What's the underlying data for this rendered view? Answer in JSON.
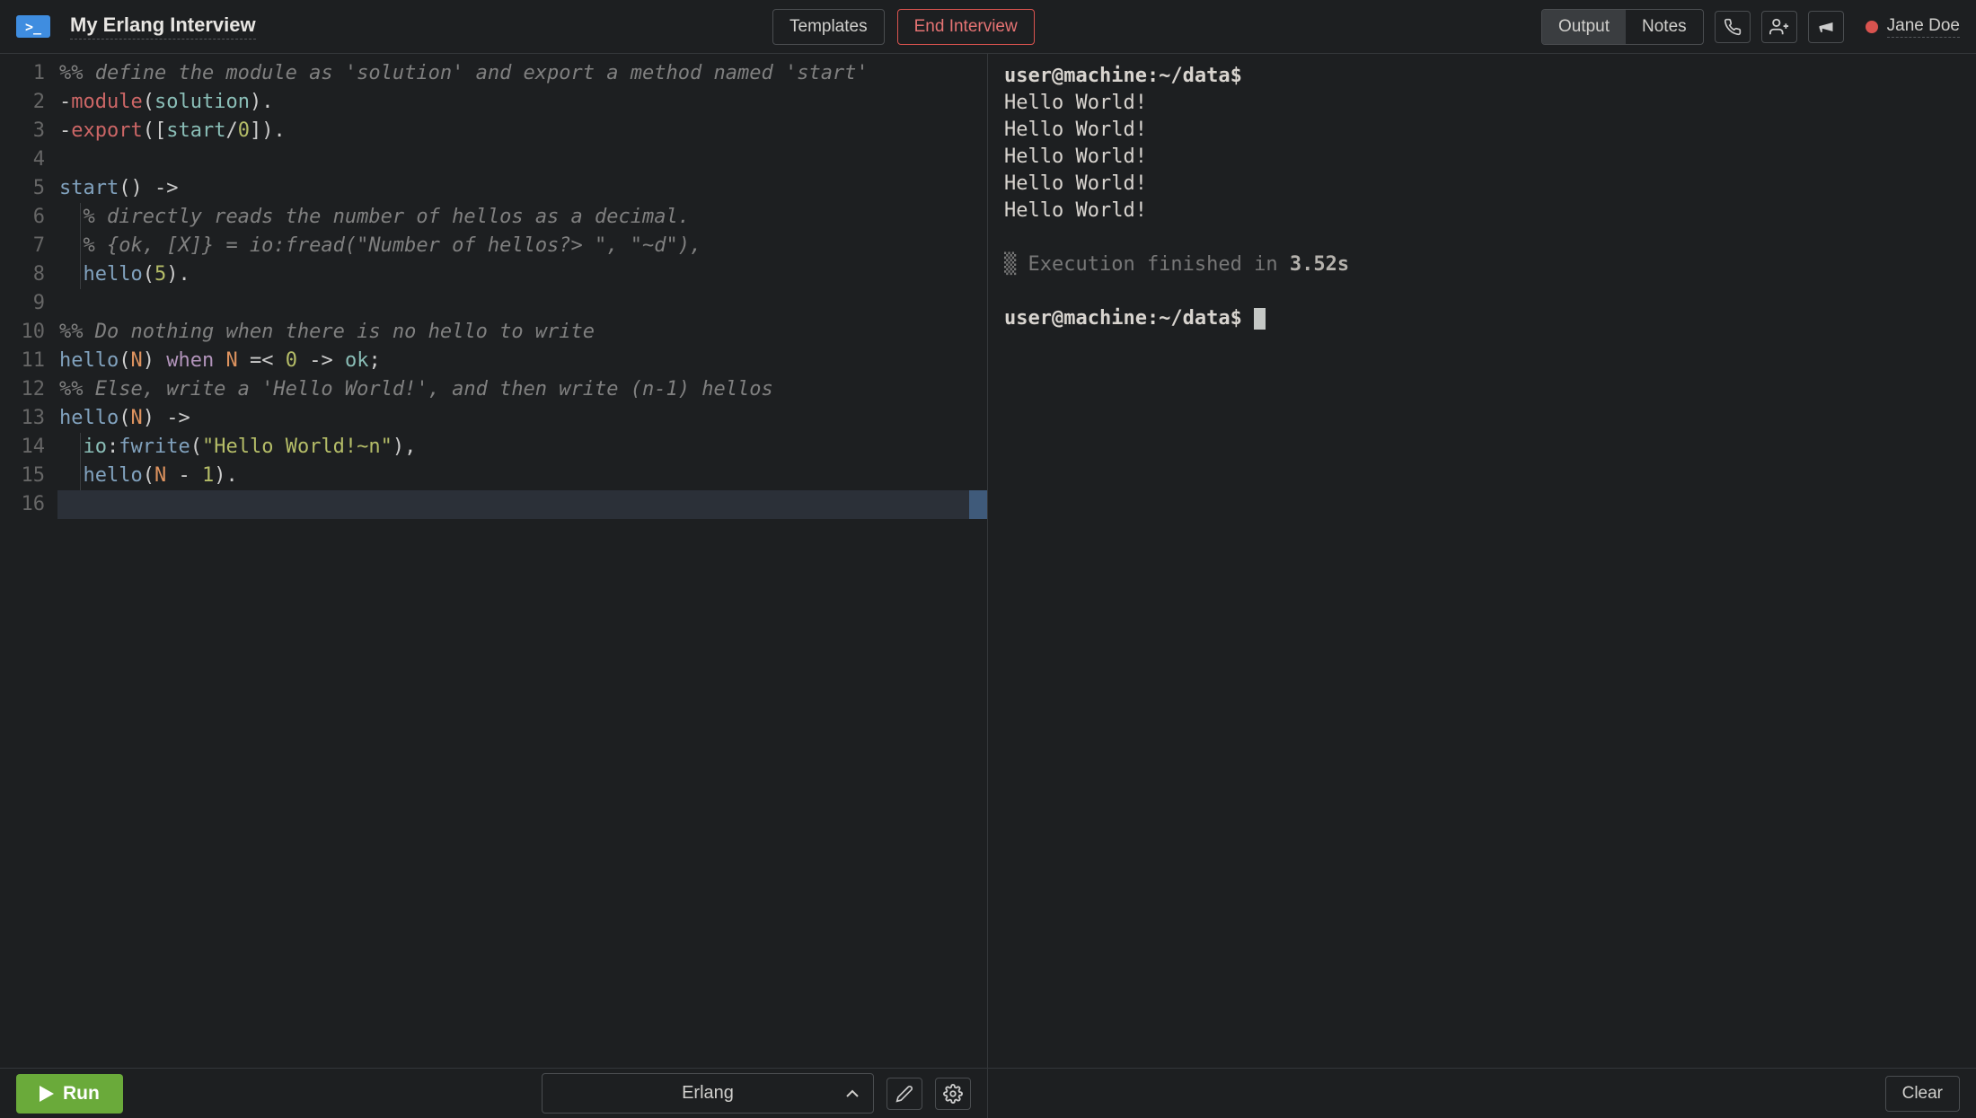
{
  "header": {
    "logo_text": ">_",
    "title": "My Erlang Interview",
    "templates_label": "Templates",
    "end_label": "End Interview"
  },
  "right_tabs": {
    "output": "Output",
    "notes": "Notes",
    "active": "output"
  },
  "user": {
    "name": "Jane Doe"
  },
  "icons": {
    "phone": "phone-icon",
    "adduser": "add-user-icon",
    "announce": "megaphone-icon"
  },
  "code": {
    "lines": [
      [
        {
          "t": "comment",
          "v": "%% define the module as 'solution' and export a method named 'start'"
        }
      ],
      [
        {
          "t": "punct",
          "v": "-"
        },
        {
          "t": "attr",
          "v": "module"
        },
        {
          "t": "punct",
          "v": "("
        },
        {
          "t": "atom",
          "v": "solution"
        },
        {
          "t": "punct",
          "v": ")."
        }
      ],
      [
        {
          "t": "punct",
          "v": "-"
        },
        {
          "t": "attr",
          "v": "export"
        },
        {
          "t": "punct",
          "v": "(["
        },
        {
          "t": "atom",
          "v": "start"
        },
        {
          "t": "punct",
          "v": "/"
        },
        {
          "t": "num",
          "v": "0"
        },
        {
          "t": "punct",
          "v": "])."
        }
      ],
      [],
      [
        {
          "t": "func",
          "v": "start"
        },
        {
          "t": "punct",
          "v": "() "
        },
        {
          "t": "punct",
          "v": "->"
        }
      ],
      [
        {
          "t": "plain",
          "v": "  "
        },
        {
          "t": "comment",
          "v": "% directly reads the number of hellos as a decimal."
        }
      ],
      [
        {
          "t": "plain",
          "v": "  "
        },
        {
          "t": "comment",
          "v": "% {ok, [X]} = io:fread(\"Number of hellos?> \", \"~d\"),"
        }
      ],
      [
        {
          "t": "plain",
          "v": "  "
        },
        {
          "t": "func",
          "v": "hello"
        },
        {
          "t": "punct",
          "v": "("
        },
        {
          "t": "num",
          "v": "5"
        },
        {
          "t": "punct",
          "v": ")."
        }
      ],
      [],
      [
        {
          "t": "comment",
          "v": "%% Do nothing when there is no hello to write"
        }
      ],
      [
        {
          "t": "func",
          "v": "hello"
        },
        {
          "t": "punct",
          "v": "("
        },
        {
          "t": "var",
          "v": "N"
        },
        {
          "t": "punct",
          "v": ") "
        },
        {
          "t": "kw",
          "v": "when"
        },
        {
          "t": "plain",
          "v": " "
        },
        {
          "t": "var",
          "v": "N"
        },
        {
          "t": "plain",
          "v": " "
        },
        {
          "t": "punct",
          "v": "=<"
        },
        {
          "t": "plain",
          "v": " "
        },
        {
          "t": "num",
          "v": "0"
        },
        {
          "t": "plain",
          "v": " "
        },
        {
          "t": "punct",
          "v": "->"
        },
        {
          "t": "plain",
          "v": " "
        },
        {
          "t": "atom",
          "v": "ok"
        },
        {
          "t": "punct",
          "v": ";"
        }
      ],
      [
        {
          "t": "comment",
          "v": "%% Else, write a 'Hello World!', and then write (n-1) hellos"
        }
      ],
      [
        {
          "t": "func",
          "v": "hello"
        },
        {
          "t": "punct",
          "v": "("
        },
        {
          "t": "var",
          "v": "N"
        },
        {
          "t": "punct",
          "v": ") "
        },
        {
          "t": "punct",
          "v": "->"
        }
      ],
      [
        {
          "t": "plain",
          "v": "  "
        },
        {
          "t": "atom",
          "v": "io"
        },
        {
          "t": "punct",
          "v": ":"
        },
        {
          "t": "func",
          "v": "fwrite"
        },
        {
          "t": "punct",
          "v": "("
        },
        {
          "t": "str",
          "v": "\"Hello World!~n\""
        },
        {
          "t": "punct",
          "v": "),"
        }
      ],
      [
        {
          "t": "plain",
          "v": "  "
        },
        {
          "t": "func",
          "v": "hello"
        },
        {
          "t": "punct",
          "v": "("
        },
        {
          "t": "var",
          "v": "N"
        },
        {
          "t": "plain",
          "v": " "
        },
        {
          "t": "punct",
          "v": "-"
        },
        {
          "t": "plain",
          "v": " "
        },
        {
          "t": "num",
          "v": "1"
        },
        {
          "t": "punct",
          "v": ")."
        }
      ],
      []
    ],
    "active_line": 16,
    "guide_lines": [
      6,
      7,
      8,
      14,
      15
    ]
  },
  "footer": {
    "run": "Run",
    "language": "Erlang",
    "clear": "Clear"
  },
  "terminal": {
    "prompt": "user@machine:~/data$",
    "hello": "Hello World!",
    "exec_prefix": "▒ Execution finished in ",
    "exec_time": "3.52s"
  }
}
